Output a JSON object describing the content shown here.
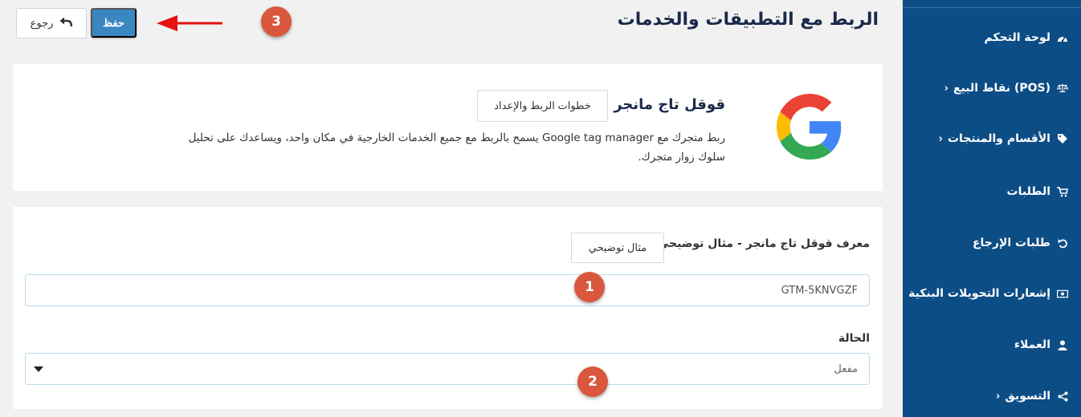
{
  "header": {
    "title": "الربط مع التطبيقات والخدمات",
    "save_label": "حفظ",
    "back_label": "رجوع"
  },
  "markers": {
    "one": "1",
    "two": "2",
    "three": "3"
  },
  "sidebar": {
    "items": [
      {
        "label": "لوحة التحكم",
        "icon": "dashboard-icon",
        "chevron": ""
      },
      {
        "label": "نقاط البيع (POS)",
        "icon": "scale-icon",
        "chevron": "›"
      },
      {
        "label": "الأقسام والمنتجات",
        "icon": "tag-icon",
        "chevron": "›"
      },
      {
        "label": "الطلبات",
        "icon": "cart-icon",
        "chevron": ""
      },
      {
        "label": "طلبات الإرجاع",
        "icon": "return-icon",
        "chevron": ""
      },
      {
        "label": "إشعارات التحويلات البنكية",
        "icon": "money-icon",
        "chevron": ""
      },
      {
        "label": "العملاء",
        "icon": "user-icon",
        "chevron": ""
      },
      {
        "label": "التسويق",
        "icon": "share-icon",
        "chevron": "›"
      }
    ]
  },
  "google_card": {
    "title": "قوقل تاج مانجر",
    "steps_label": "خطوات الربط والإعداد",
    "description": "ربط متجرك مع Google tag manager يسمح بالربط مع جميع الخدمات الخارجية في مكان واحد، ويساعدك على تحليل سلوك زوار متجرك."
  },
  "form": {
    "id_label": "معرف قوقل تاج مانجر - مثال توضيحي:",
    "example_label": "مثال توضيحي",
    "id_value": "GTM-5KNVGZF",
    "status_label": "الحالة",
    "status_value": "مفعل"
  },
  "colors": {
    "sidebar": "#0d4d86",
    "primary": "#3a86c1",
    "marker": "#d9573d",
    "arrow": "#e4120f"
  }
}
